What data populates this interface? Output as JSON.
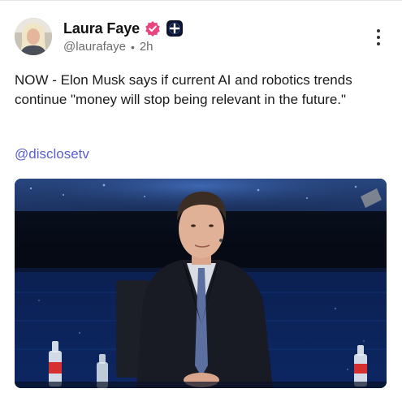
{
  "post": {
    "author": {
      "display_name": "Laura Faye",
      "handle": "@laurafaye",
      "time": "2h",
      "separator": "•",
      "verified_icon": "verified-badge-icon",
      "subscriber_icon": "plus-badge-icon",
      "avatar": "avatar-image"
    },
    "text": "NOW - Elon Musk says if current AI and robotics trends continue \"money will stop being relevant in the future.\"",
    "mention": "@disclosetv",
    "more_icon": "more-vertical-icon",
    "media": {
      "type": "video-still",
      "description_icon": "video-thumbnail"
    }
  },
  "colors": {
    "verified_badge": "#e8457e",
    "mention": "#5b5fc7",
    "stage_background": "#0b1b3a"
  }
}
